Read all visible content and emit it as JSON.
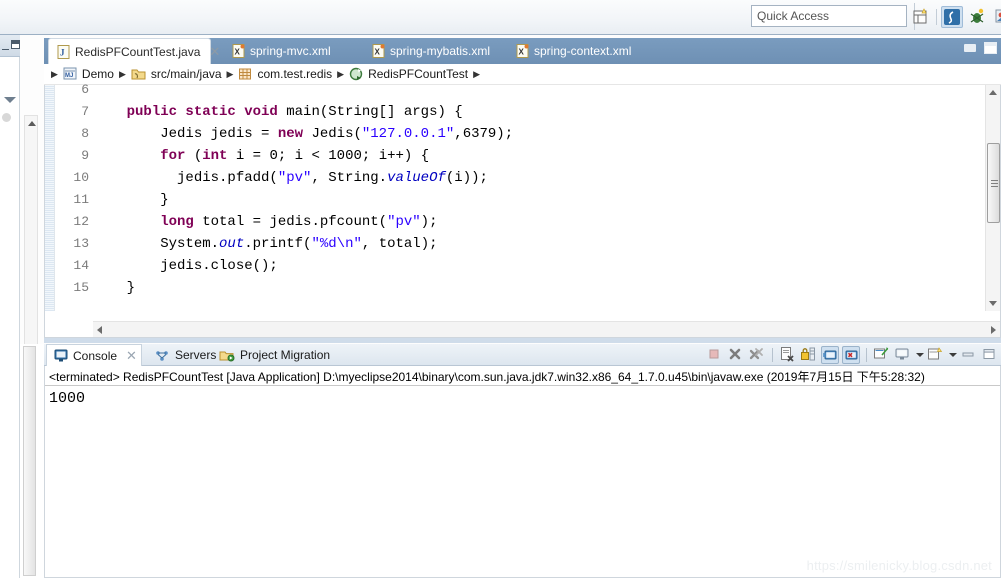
{
  "toolbar": {
    "quick_access_placeholder": "Quick Access",
    "icons": [
      "new-wizard-icon",
      "java-perspective-icon",
      "debug-perspective-icon",
      "myeclipse-perspective-icon"
    ]
  },
  "editor": {
    "tabs": [
      {
        "label": "RedisPFCountTest.java",
        "icon": "java-file-icon",
        "active": true,
        "closable": true
      },
      {
        "label": "spring-mvc.xml",
        "icon": "xml-file-icon",
        "active": false,
        "closable": false
      },
      {
        "label": "spring-mybatis.xml",
        "icon": "xml-file-icon",
        "active": false,
        "closable": false
      },
      {
        "label": "spring-context.xml",
        "icon": "xml-file-icon",
        "active": false,
        "closable": false
      }
    ],
    "window_buttons": [
      "minimize",
      "maximize"
    ],
    "breadcrumb": [
      {
        "label": "Demo",
        "icon": "java-project-icon"
      },
      {
        "label": "src/main/java",
        "icon": "source-folder-icon"
      },
      {
        "label": "com.test.redis",
        "icon": "package-icon"
      },
      {
        "label": "RedisPFCountTest",
        "icon": "class-runnable-icon"
      }
    ],
    "lines": [
      {
        "num": "6",
        "fold": false,
        "indent": 0,
        "tokens": []
      },
      {
        "num": "7",
        "fold": true,
        "indent": 0,
        "tokens": [
          {
            "t": "    ",
            "c": "pln"
          },
          {
            "t": "public static void",
            "c": "kw"
          },
          {
            "t": " main(String[] args) {",
            "c": "pln"
          }
        ]
      },
      {
        "num": "8",
        "fold": false,
        "indent": 0,
        "tokens": [
          {
            "t": "        Jedis jedis = ",
            "c": "pln"
          },
          {
            "t": "new",
            "c": "kw"
          },
          {
            "t": " Jedis(",
            "c": "pln"
          },
          {
            "t": "\"127.0.0.1\"",
            "c": "str"
          },
          {
            "t": ",6379);",
            "c": "pln"
          }
        ]
      },
      {
        "num": "9",
        "fold": false,
        "indent": 0,
        "tokens": [
          {
            "t": "        ",
            "c": "pln"
          },
          {
            "t": "for",
            "c": "kw"
          },
          {
            "t": " (",
            "c": "pln"
          },
          {
            "t": "int",
            "c": "kw"
          },
          {
            "t": " i = 0; i < 1000; i++) {",
            "c": "pln"
          }
        ]
      },
      {
        "num": "10",
        "fold": false,
        "indent": 0,
        "tokens": [
          {
            "t": "          jedis.pfadd(",
            "c": "pln"
          },
          {
            "t": "\"pv\"",
            "c": "str"
          },
          {
            "t": ", String.",
            "c": "pln"
          },
          {
            "t": "valueOf",
            "c": "stat"
          },
          {
            "t": "(i));",
            "c": "pln"
          }
        ]
      },
      {
        "num": "11",
        "fold": false,
        "indent": 0,
        "tokens": [
          {
            "t": "        }",
            "c": "pln"
          }
        ]
      },
      {
        "num": "12",
        "fold": false,
        "indent": 0,
        "tokens": [
          {
            "t": "        ",
            "c": "pln"
          },
          {
            "t": "long",
            "c": "kw"
          },
          {
            "t": " total = jedis.pfcount(",
            "c": "pln"
          },
          {
            "t": "\"pv\"",
            "c": "str"
          },
          {
            "t": ");",
            "c": "pln"
          }
        ]
      },
      {
        "num": "13",
        "fold": false,
        "indent": 0,
        "tokens": [
          {
            "t": "        System.",
            "c": "pln"
          },
          {
            "t": "out",
            "c": "stat"
          },
          {
            "t": ".printf(",
            "c": "pln"
          },
          {
            "t": "\"%d\\n\"",
            "c": "str"
          },
          {
            "t": ", total);",
            "c": "pln"
          }
        ]
      },
      {
        "num": "14",
        "fold": false,
        "indent": 0,
        "tokens": [
          {
            "t": "        jedis.close();",
            "c": "pln"
          }
        ]
      },
      {
        "num": "15",
        "fold": false,
        "indent": 0,
        "tokens": [
          {
            "t": "    }",
            "c": "pln"
          }
        ]
      }
    ]
  },
  "console": {
    "tabs": [
      {
        "label": "Console",
        "icon": "console-icon",
        "active": true,
        "closable": true
      },
      {
        "label": "Servers",
        "icon": "servers-icon",
        "active": false,
        "closable": false
      },
      {
        "label": "Project Migration",
        "icon": "project-migration-icon",
        "active": false,
        "closable": false
      }
    ],
    "tools": [
      "terminate-icon",
      "remove-launch-icon",
      "remove-all-launches-icon",
      "clear-console-icon",
      "scroll-lock-icon",
      "show-console-on-output-icon",
      "show-console-on-error-icon",
      "pin-console-icon",
      "display-selected-console-icon",
      "open-console-icon",
      "minimize-icon",
      "maximize-icon"
    ],
    "launch_line": "<terminated> RedisPFCountTest [Java Application] D:\\myeclipse2014\\binary\\com.sun.java.jdk7.win32.x86_64_1.7.0.u45\\bin\\javaw.exe (2019年7月15日 下午5:28:32)",
    "output": "1000"
  },
  "watermark": "https://smilenicky.blog.csdn.net",
  "colors": {
    "tab_active_bg": "#ffffff",
    "tabbar_bg": "#6e90b4",
    "keyword": "#7f0055",
    "string": "#2a00ff",
    "static_member": "#0000c0",
    "accent": "#cfdcea"
  }
}
